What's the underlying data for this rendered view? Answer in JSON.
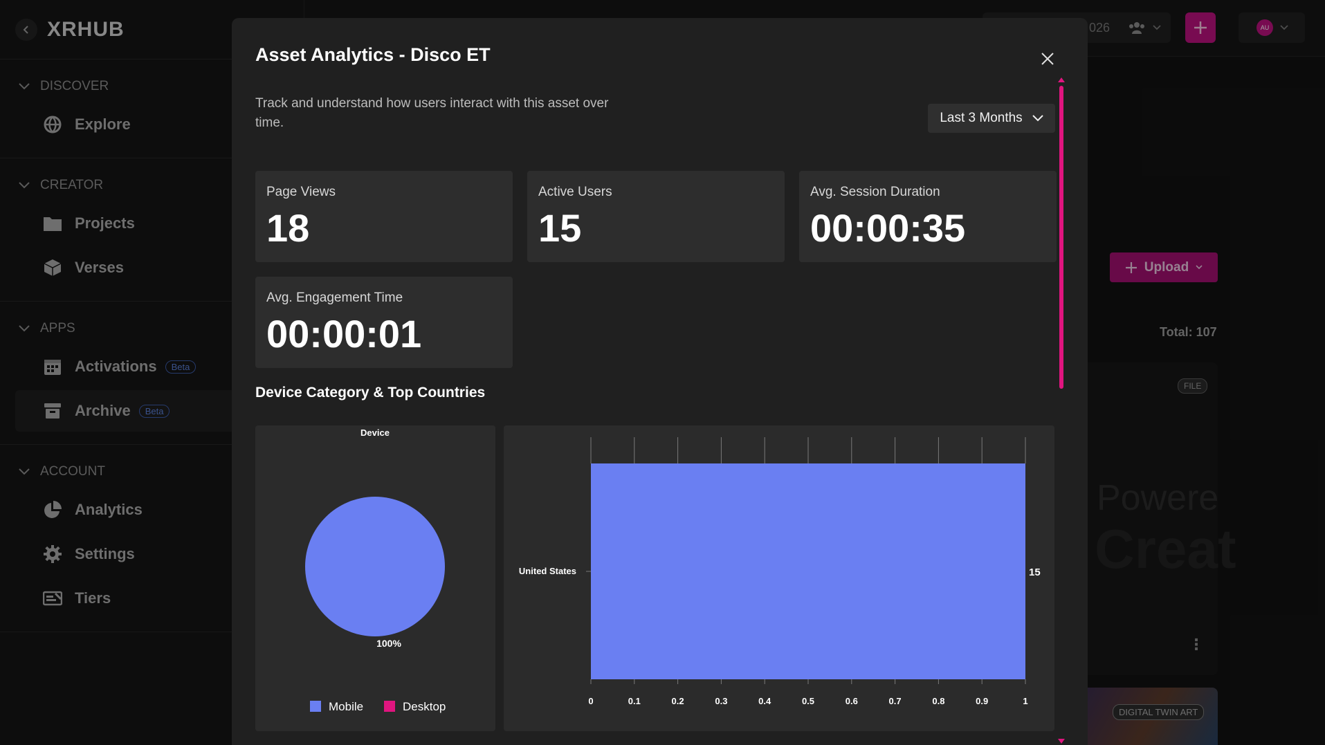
{
  "sidebar": {
    "brand": "XRHUB",
    "sections": [
      {
        "label": "DISCOVER",
        "items": [
          {
            "label": "Explore",
            "icon": "globe-icon"
          }
        ]
      },
      {
        "label": "CREATOR",
        "items": [
          {
            "label": "Projects",
            "icon": "folder-icon"
          },
          {
            "label": "Verses",
            "icon": "cube-icon"
          }
        ]
      },
      {
        "label": "APPS",
        "items": [
          {
            "label": "Activations",
            "icon": "calendar-icon",
            "badge": "Beta"
          },
          {
            "label": "Archive",
            "icon": "archive-icon",
            "badge": "Beta"
          }
        ]
      },
      {
        "label": "ACCOUNT",
        "items": [
          {
            "label": "Analytics",
            "icon": "pie-chart-icon"
          },
          {
            "label": "Settings",
            "icon": "gear-icon"
          },
          {
            "label": "Tiers",
            "icon": "tiers-icon"
          }
        ]
      }
    ]
  },
  "topbar": {
    "partial_text": "026",
    "avatar_initials": "AU"
  },
  "background": {
    "upload_label": "Upload",
    "total_label": "Total: 107",
    "file_badge": "FILE",
    "card_text_1": "Powere",
    "card_text_2": "Creat",
    "twin_badge": "DIGITAL TWIN ART"
  },
  "modal": {
    "title": "Asset Analytics - Disco ET",
    "description": "Track and understand how users interact with this asset over time.",
    "range_label": "Last 3 Months",
    "stats": [
      {
        "label": "Page Views",
        "value": "18"
      },
      {
        "label": "Active Users",
        "value": "15"
      },
      {
        "label": "Avg. Session Duration",
        "value": "00:00:35"
      },
      {
        "label": "Avg. Engagement Time",
        "value": "00:00:01"
      }
    ],
    "section_title": "Device Category & Top Countries"
  },
  "colors": {
    "accent": "#e0157f",
    "mobile": "#6a7ff2",
    "desktop": "#e0157f"
  },
  "chart_data": [
    {
      "type": "pie",
      "title": "Device",
      "categories": [
        "Mobile",
        "Desktop"
      ],
      "values": [
        100,
        0
      ],
      "slice_label": "100%",
      "legend": "bottom"
    },
    {
      "type": "bar",
      "orientation": "horizontal",
      "categories": [
        "United States"
      ],
      "values": [
        15
      ],
      "data_labels": [
        "15"
      ],
      "xlim": [
        0,
        1
      ],
      "xticks": [
        "0",
        "0.1",
        "0.2",
        "0.3",
        "0.4",
        "0.5",
        "0.6",
        "0.7",
        "0.8",
        "0.9",
        "1"
      ],
      "grid": true
    }
  ]
}
